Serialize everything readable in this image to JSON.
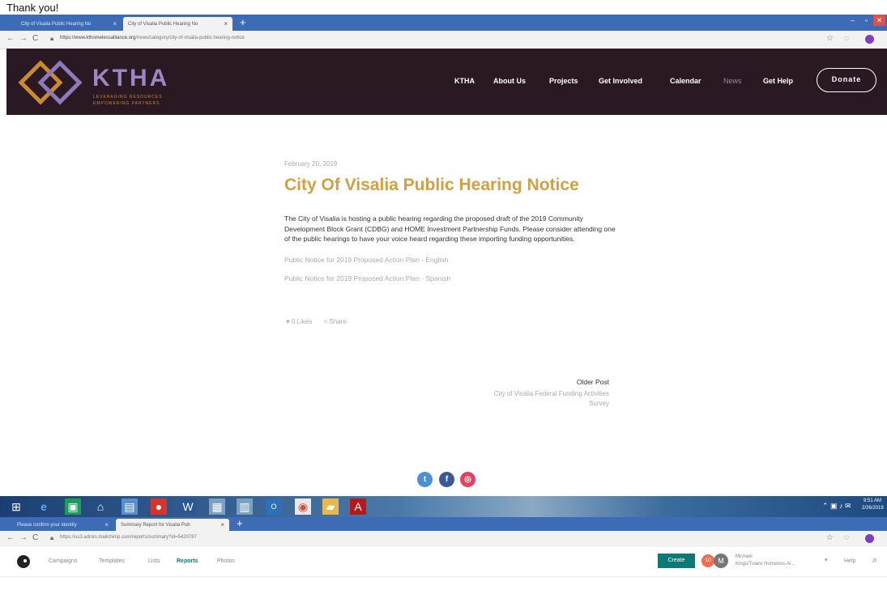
{
  "caption": "Thank you!",
  "top_browser": {
    "tabs": [
      {
        "label": "City of Visalia Public Hearing No",
        "close": "×"
      },
      {
        "label": "City of Visalia Public Hearing No",
        "close": "×"
      }
    ],
    "new_tab": "+",
    "url_host": "https://www.kthomelessalliance.org",
    "url_path": "/news/category/city-of-visalia-public-hearing-notice",
    "window_controls": [
      "–",
      "▫",
      "✕"
    ]
  },
  "site": {
    "logo_title": "KTHA",
    "logo_sub1": "LEVERAGING RESOURCES",
    "logo_sub2": "EMPOWERING PARTNERS",
    "nav": [
      "KTHA",
      "About Us",
      "Projects",
      "Get Involved",
      "Calendar",
      "News",
      "Get Help"
    ],
    "donate": "Donate"
  },
  "article": {
    "date": "February 20, 2019",
    "title": "City Of Visalia Public Hearing Notice",
    "body": "The City of Visalia is hosting a public hearing regarding the proposed draft of the 2019 Community Development Block Grant (CDBG) and HOME Investment Partnership Funds. Please consider attending one of the public hearings to have your voice heard regarding these importing funding opportunities.",
    "link1": "Public Notice for 2019 Proposed Action Plan - English",
    "link2": "Public Notice for 2019 Proposed Action Plan - Spanish",
    "likes": "0 Likes",
    "share": "Share",
    "older_label": "Older Post",
    "older_title_1": "City of Visalia Federal Funding Activities",
    "older_title_2": "Survey"
  },
  "social": [
    "twitter",
    "facebook",
    "instagram"
  ],
  "taskbar": {
    "time": "9:51 AM",
    "date": "2/26/2019"
  },
  "bottom_browser": {
    "tabs": [
      {
        "label": "Please confirm your identity",
        "close": "×"
      },
      {
        "label": "Summary Report for Visalia Pub",
        "close": "×"
      }
    ],
    "new_tab": "+",
    "url": "https://us3.admin.mailchimp.com/reports/summary?id=5420787"
  },
  "mailchimp": {
    "nav": [
      "Campaigns",
      "Templates",
      "Lists",
      "Reports",
      "Photos"
    ],
    "create": "Create",
    "badge": "10",
    "avatar": "M",
    "user_name": "Michael",
    "account": "Kings/Tulare Homeless Al...",
    "help": "Help"
  }
}
